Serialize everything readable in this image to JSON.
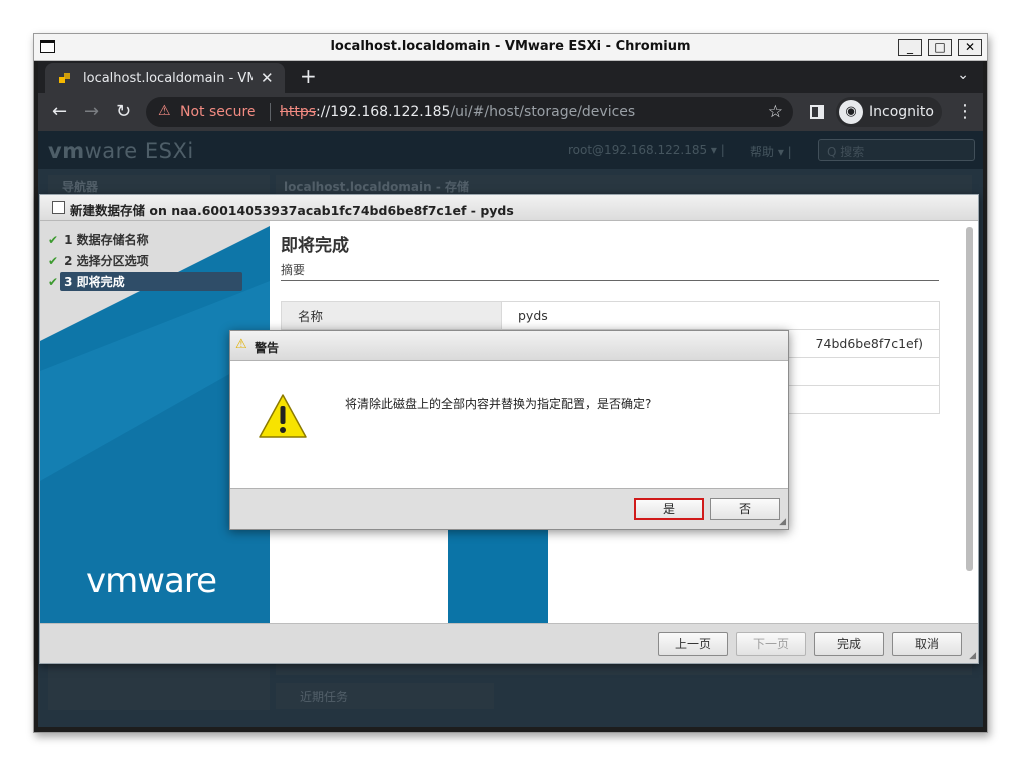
{
  "window": {
    "title": "localhost.localdomain - VMware ESXi - Chromium",
    "min": "_",
    "max": "□",
    "close": "✕"
  },
  "tab": {
    "label": "localhost.localdomain - VMware ESXi",
    "close": "✕",
    "new_tab": "+",
    "menu": "⌄"
  },
  "toolbar": {
    "back": "←",
    "forward": "→",
    "reload": "↻",
    "security_icon": "⚠",
    "security_label": "Not secure",
    "url_proto": "https",
    "url_host": "://192.168.122.185",
    "url_path": "/ui/#/host/storage/devices",
    "star": "☆",
    "incognito_label": "Incognito",
    "menu": "⋮"
  },
  "esxi": {
    "logo_main": "vm",
    "logo_rest": "ware ESXi",
    "user": "root@192.168.122.185 ▾  |",
    "help": "帮助 ▾  |",
    "search_placeholder": "Q 搜索",
    "navigator": "导航器",
    "main_title": "localhost.localdomain - 存储",
    "recent_tasks": "近期任务"
  },
  "wizard": {
    "title": "新建数据存储 on naa.60014053937acab1fc74bd6be8f7c1ef - pyds",
    "steps": [
      {
        "label": "1 数据存储名称",
        "check": "✔"
      },
      {
        "label": "2 选择分区选项",
        "check": "✔"
      },
      {
        "label": "3 即将完成",
        "check": "✔"
      }
    ],
    "logo_main": "vm",
    "logo_rest": "ware",
    "heading": "即将完成",
    "subheading": "摘要",
    "summary": [
      {
        "key": "名称",
        "value": "pyds"
      },
      {
        "key": "",
        "value": "74bd6be8f7c1ef)"
      },
      {
        "key": "",
        "value": ""
      },
      {
        "key": "",
        "value": ""
      }
    ],
    "buttons": {
      "back": "上一页",
      "next": "下一页",
      "finish": "完成",
      "cancel": "取消"
    }
  },
  "alert": {
    "title": "警告",
    "message": "将清除此磁盘上的全部内容并替换为指定配置，是否确定?",
    "yes": "是",
    "no": "否"
  }
}
